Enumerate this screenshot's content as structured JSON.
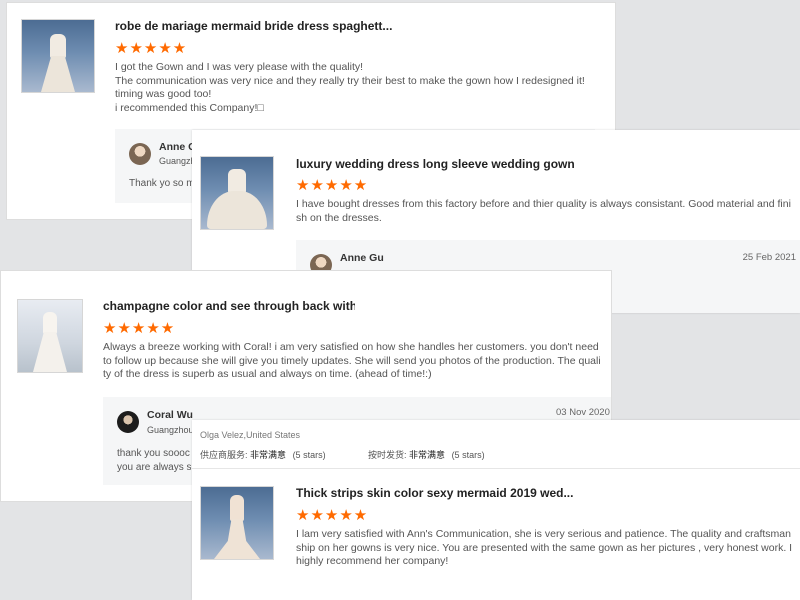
{
  "review1": {
    "title": "robe de mariage mermaid bride dress spaghett...",
    "stars": "★★★★★",
    "text_lines": [
      "I got the Gown and I was very please with the quality!",
      "The communication was very nice and they really try their best to make the gown how I redesigned it!",
      "timing was good too!",
      "i recommended this Company!□"
    ],
    "reply": {
      "name": "Anne Gu",
      "location": "Guangzh",
      "text": "Thank yo so m"
    }
  },
  "review2": {
    "title": "luxury wedding dress long sleeve wedding gown",
    "stars": "★★★★★",
    "text_lines": [
      "I have bought dresses from this factory before and thier quality is always consistant. Good material and fini",
      "sh on the dresses."
    ],
    "reply": {
      "name": "Anne Gu",
      "date": "25 Feb 2021"
    }
  },
  "review3": {
    "title": "champagne color and see through back with la",
    "stars": "★★★★★",
    "text_lines": [
      "Always a breeze working with Coral! i am very satisfied on how she handles her customers. you don't need",
      "to follow up because she will give you timely updates. She will send you photos of the production. The quali",
      "ty of the dress is superb as usual and always on time. (ahead of time!:)"
    ],
    "reply": {
      "name": "Coral Wu",
      "location": "Guangzhou",
      "date": "03 Nov 2020",
      "text_lines": [
        "thank you soooc",
        "you are always s"
      ]
    }
  },
  "review4": {
    "reviewer": "Olga Velez,United States",
    "supplier_service_label": "供应商服务:",
    "supplier_service_value": "非常满意",
    "supplier_service_stars": "(5 stars)",
    "ontime_label": "按时发货:",
    "ontime_value": "非常满意",
    "ontime_stars": "(5 stars)",
    "title": "Thick strips skin color sexy mermaid 2019 wed...",
    "stars": "★★★★★",
    "text_lines": [
      "I lam very satisfied with Ann's Communication, she is very serious and patience. The quality and craftsman",
      "ship on her gowns is very nice. You are presented with the same gown as her pictures , very honest work. I",
      "highly recommend her company!"
    ]
  },
  "colors": {
    "star": "#ff6a00",
    "background": "#e3e4e6"
  }
}
